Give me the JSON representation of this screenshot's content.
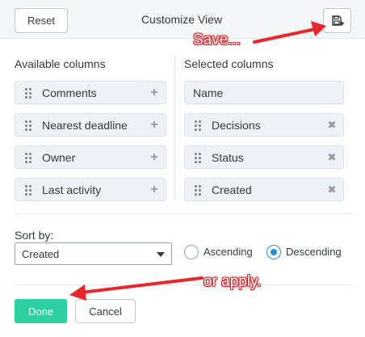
{
  "header": {
    "reset_label": "Reset",
    "title": "Customize View",
    "save_icon": "save-icon"
  },
  "available": {
    "title": "Available columns",
    "items": [
      {
        "label": "Comments",
        "action": "+"
      },
      {
        "label": "Nearest deadline",
        "action": "+"
      },
      {
        "label": "Owner",
        "action": "+"
      },
      {
        "label": "Last activity",
        "action": "+"
      }
    ]
  },
  "selected": {
    "title": "Selected columns",
    "items": [
      {
        "label": "Name",
        "action": ""
      },
      {
        "label": "Decisions",
        "action": "✖"
      },
      {
        "label": "Status",
        "action": "✖"
      },
      {
        "label": "Created",
        "action": "✖"
      }
    ]
  },
  "sort": {
    "label": "Sort by:",
    "selected_value": "Created",
    "ascending_label": "Ascending",
    "descending_label": "Descending",
    "selected_order": "Descending"
  },
  "footer": {
    "done_label": "Done",
    "cancel_label": "Cancel"
  },
  "annotations": {
    "save_note": "Save...",
    "apply_note": "or apply.",
    "color": "#e8262c"
  },
  "colors": {
    "done_button": "#2ecfa1",
    "radio_selected": "#2b8fd6"
  }
}
